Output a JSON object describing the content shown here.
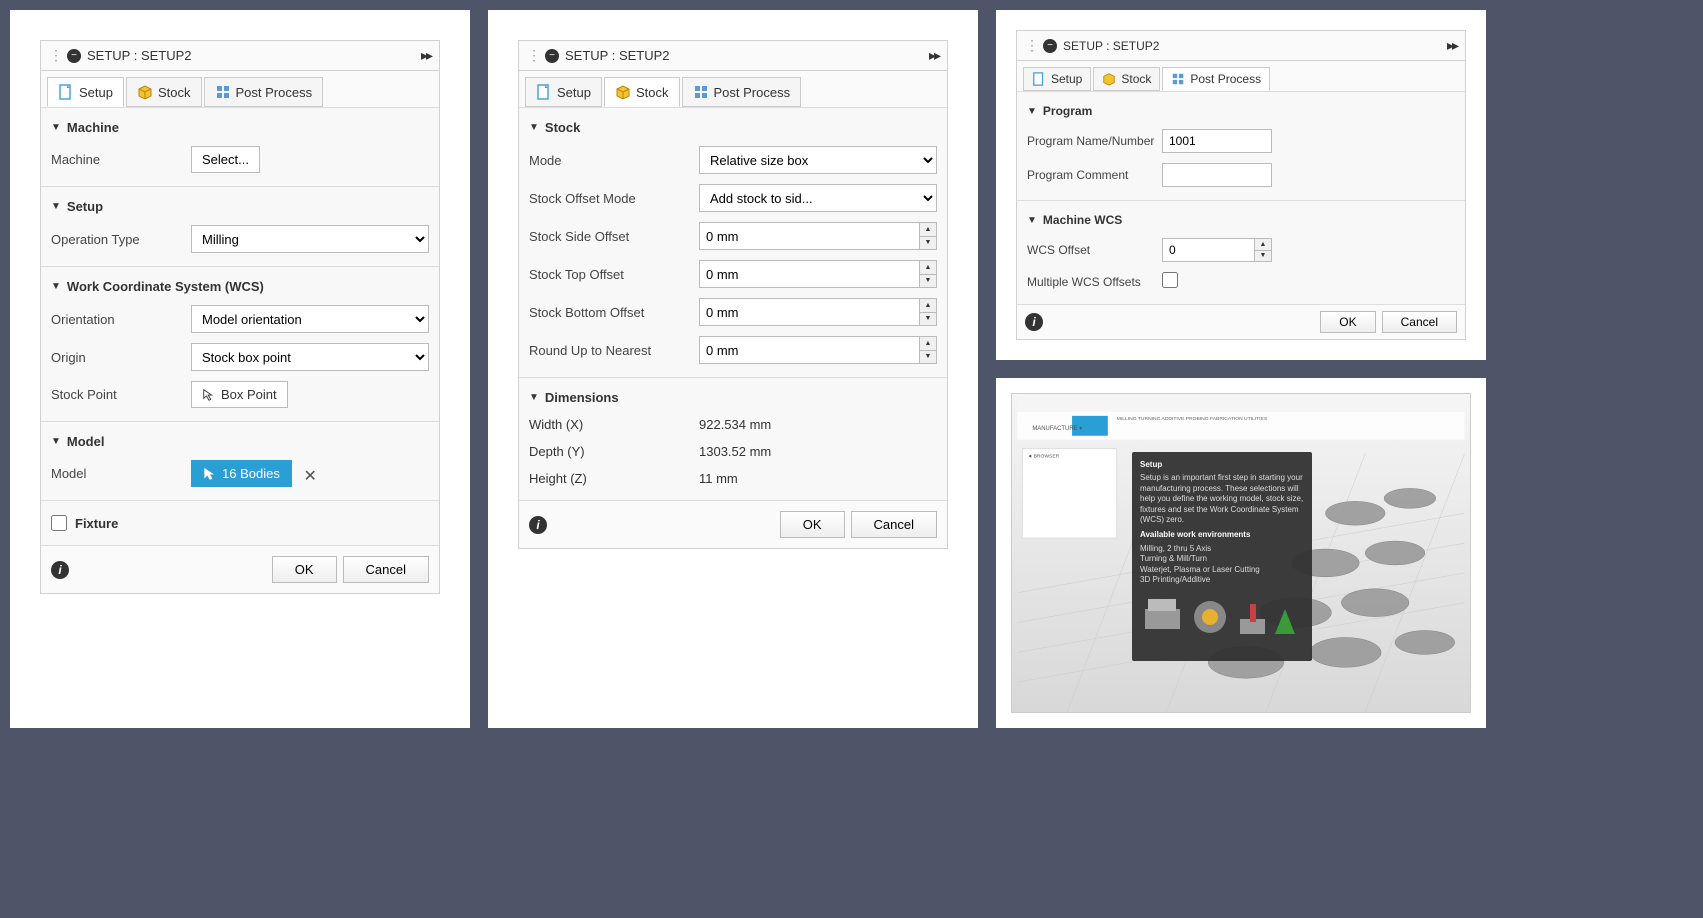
{
  "panelTitle": "SETUP : SETUP2",
  "tabs": {
    "setup": "Setup",
    "stock": "Stock",
    "post": "Post Process"
  },
  "p1": {
    "sections": {
      "machine": "Machine",
      "setup": "Setup",
      "wcs": "Work Coordinate System (WCS)",
      "model": "Model",
      "fixture": "Fixture"
    },
    "labels": {
      "machine": "Machine",
      "opType": "Operation Type",
      "orientation": "Orientation",
      "origin": "Origin",
      "stockPoint": "Stock Point",
      "model": "Model"
    },
    "values": {
      "machineBtn": "Select...",
      "opType": "Milling",
      "orientation": "Model orientation",
      "origin": "Stock box point",
      "boxPoint": "Box Point",
      "bodies": "16 Bodies"
    }
  },
  "p2": {
    "sections": {
      "stock": "Stock",
      "dimensions": "Dimensions"
    },
    "labels": {
      "mode": "Mode",
      "offsetMode": "Stock Offset Mode",
      "side": "Stock Side Offset",
      "top": "Stock Top Offset",
      "bottom": "Stock Bottom Offset",
      "round": "Round Up to Nearest",
      "width": "Width (X)",
      "depth": "Depth (Y)",
      "height": "Height (Z)"
    },
    "values": {
      "mode": "Relative size box",
      "offsetMode": "Add stock to sid...",
      "side": "0 mm",
      "top": "0 mm",
      "bottom": "0 mm",
      "round": "0 mm",
      "width": "922.534 mm",
      "depth": "1303.52 mm",
      "height": "11 mm"
    }
  },
  "p3": {
    "sections": {
      "program": "Program",
      "wcs": "Machine WCS"
    },
    "labels": {
      "name": "Program Name/Number",
      "comment": "Program Comment",
      "wcsOffset": "WCS Offset",
      "multi": "Multiple WCS Offsets"
    },
    "values": {
      "name": "1001",
      "comment": "",
      "wcsOffset": "0"
    }
  },
  "buttons": {
    "ok": "OK",
    "cancel": "Cancel"
  },
  "viewport": {
    "tooltipTitle": "Setup",
    "tooltipBody": "Setup is an important first step in starting your manufacturing process. These selections will help you define the working model, stock size, fixtures and set the Work Coordinate System (WCS) zero.",
    "envHeader": "Available work environments",
    "env1": "Milling, 2 thru 5 Axis",
    "env2": "Turning & Mill/Turn",
    "env3": "Waterjet, Plasma or Laser Cutting",
    "env4": "3D Printing/Additive"
  }
}
